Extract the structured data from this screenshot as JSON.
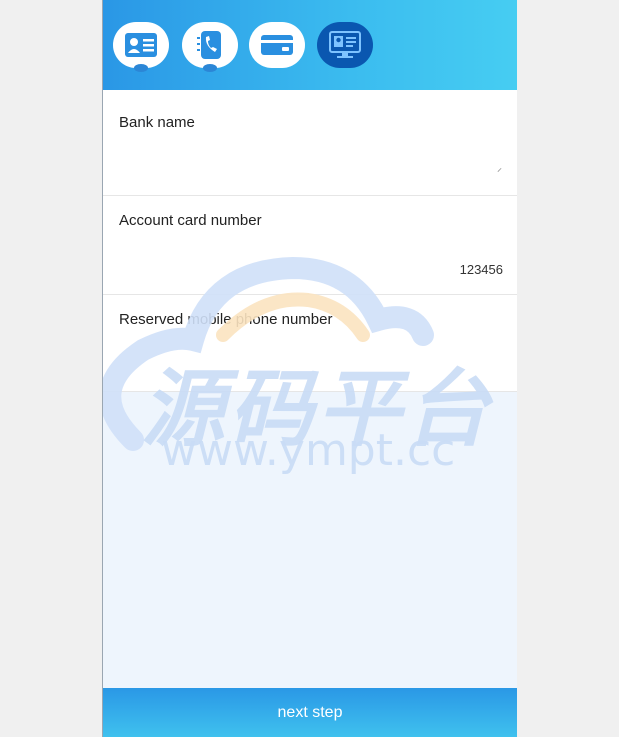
{
  "steps": [
    {
      "icon": "id-card-icon",
      "active": false
    },
    {
      "icon": "phone-icon",
      "active": false
    },
    {
      "icon": "bank-card-icon",
      "active": false
    },
    {
      "icon": "id-badge-icon",
      "active": true
    }
  ],
  "form": {
    "bank_name": {
      "label": "Bank name",
      "value": "",
      "marker": "⸝"
    },
    "card_number": {
      "label": "Account card number",
      "value": "123456"
    },
    "phone": {
      "label": "Reserved mobile phone number",
      "value": ""
    }
  },
  "watermark": {
    "cn_text": "源码平台",
    "url_text": "www.ympt.cc"
  },
  "footer": {
    "next_label": "next step"
  },
  "colors": {
    "header_start": "#2a97e6",
    "header_end": "#46cdf2",
    "active_step": "#0a57b0",
    "footer": "#2a98e6"
  }
}
